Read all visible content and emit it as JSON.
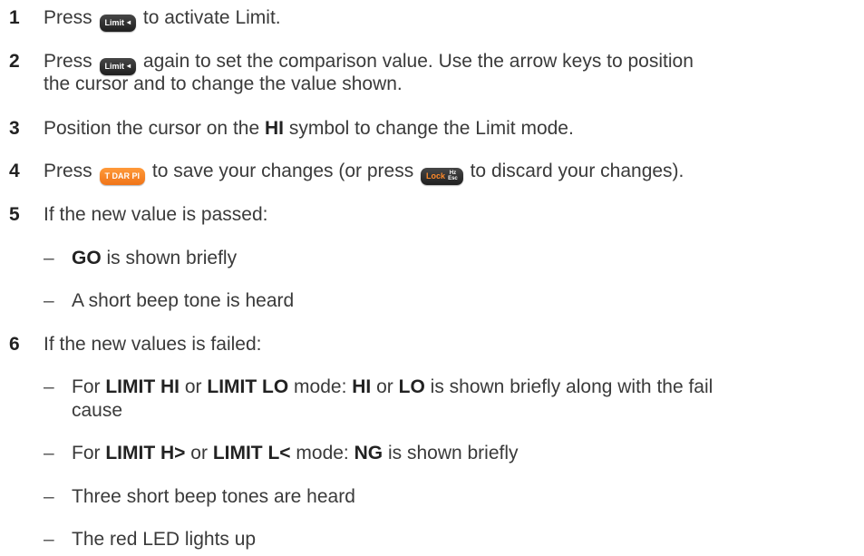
{
  "steps": [
    {
      "num": "1",
      "pre": "Press",
      "key": "Limit",
      "key_suffix": "◂",
      "post": "to activate Limit."
    },
    {
      "num": "2",
      "pre": "Press",
      "key": "Limit",
      "key_suffix": "◂",
      "post": "again to set the comparison value. Use the arrow keys to position",
      "line2": "the cursor and to change the value shown."
    },
    {
      "num": "3",
      "pre": "Position the cursor on the",
      "bold": "HI",
      "post": "symbol to change the Limit mode."
    },
    {
      "num": "4",
      "pre": "Press",
      "key": "T DAR PI",
      "mid": "to save your changes (or press",
      "key2": "Lock",
      "key2_top": "Hz",
      "key2_bottom": "Esc",
      "post": "to discard your changes)."
    },
    {
      "num": "5",
      "text": "If the new value is passed:",
      "sub": [
        {
          "dash": "–",
          "bold": "GO",
          "text": "is shown briefly"
        },
        {
          "dash": "–",
          "text": "A short beep tone is heard"
        }
      ]
    },
    {
      "num": "6",
      "text": "If the new values is failed:",
      "sub": [
        {
          "dash": "–",
          "t1": "For",
          "b1": "LIMIT HI",
          "t2": "or",
          "b2": "LIMIT LO",
          "t3": "mode:",
          "b3": "HI",
          "t4": "or",
          "b4": "LO",
          "t5": "is shown briefly along with the fail",
          "line2": "cause"
        },
        {
          "dash": "–",
          "t1": "For",
          "b1": "LIMIT H>",
          "t2": "or",
          "b2": "LIMIT L<",
          "t3": "mode:",
          "b3": "NG",
          "t4": "is shown briefly"
        },
        {
          "dash": "–",
          "text": "Three short beep tones are heard"
        },
        {
          "dash": "–",
          "text": "The red LED lights up"
        }
      ]
    }
  ]
}
